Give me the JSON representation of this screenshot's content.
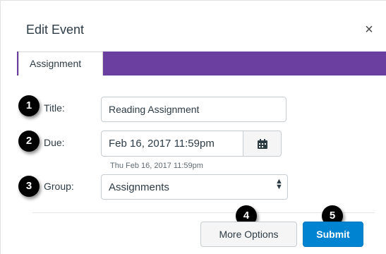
{
  "dialog": {
    "title": "Edit Event",
    "close_glyph": "×",
    "tab_label": "Assignment"
  },
  "form": {
    "title_label": "Title:",
    "title_value": "Reading Assignment",
    "due_label": "Due:",
    "due_value": "Feb 16, 2017 11:59pm",
    "due_hint": "Thu Feb 16, 2017 11:59pm",
    "group_label": "Group:",
    "group_value": "Assignments"
  },
  "buttons": {
    "more_options": "More Options",
    "submit": "Submit"
  },
  "badges": [
    "1",
    "2",
    "3",
    "4",
    "5"
  ],
  "icons": {
    "calendar": "calendar-icon",
    "select": "select-arrows-icon",
    "close": "close-icon"
  },
  "colors": {
    "tab_bar": "#6b3fa0",
    "submit": "#0084d1",
    "badge": "#000000"
  }
}
